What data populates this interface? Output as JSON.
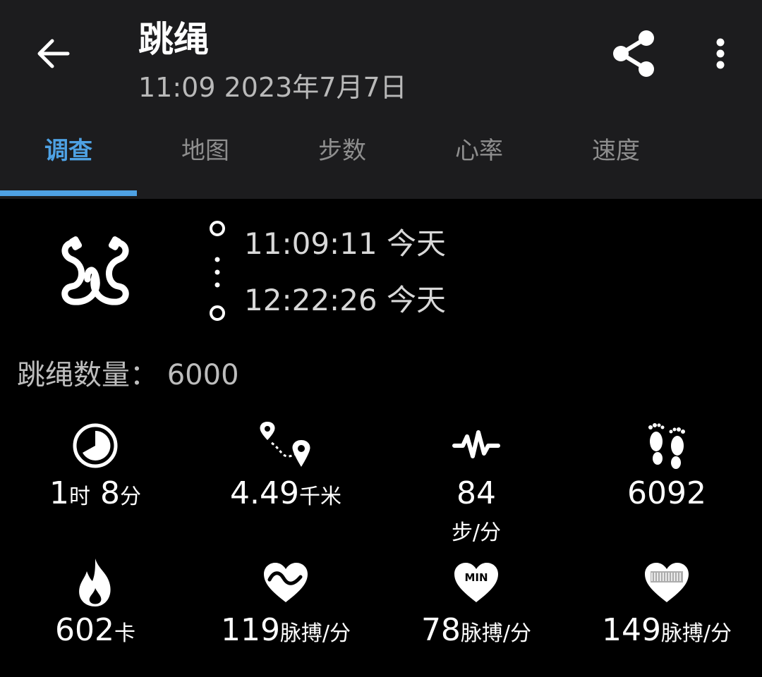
{
  "header": {
    "title": "跳绳",
    "subtitle": "11:09 2023年7月7日",
    "back_icon": "arrow-left-icon",
    "share_icon": "share-icon",
    "more_icon": "more-vert-icon"
  },
  "tabs": [
    {
      "label": "调查",
      "active": true
    },
    {
      "label": "地图",
      "active": false
    },
    {
      "label": "步数",
      "active": false
    },
    {
      "label": "心率",
      "active": false
    },
    {
      "label": "速度",
      "active": false
    }
  ],
  "accent_color": "#4ea1e3",
  "summary": {
    "activity_icon": "jump-rope-icon",
    "start_time": "11:09:11 今天",
    "end_time": "12:22:26 今天",
    "count_label": "跳绳数量：",
    "count_value": "6000"
  },
  "stats": [
    {
      "icon": "clock-icon",
      "value": "1",
      "unit": "时",
      "value2": " 8",
      "unit2": "分"
    },
    {
      "icon": "route-icon",
      "value": "4.49",
      "unit": "千米"
    },
    {
      "icon": "cadence-icon",
      "value": "84",
      "unit": "步/分"
    },
    {
      "icon": "footprints-icon",
      "value": "6092",
      "unit": ""
    },
    {
      "icon": "flame-icon",
      "value": "602",
      "unit": "卡"
    },
    {
      "icon": "heart-wave-icon",
      "value": "119",
      "unit": "脉搏/分"
    },
    {
      "icon": "heart-min-icon",
      "icon_text": "MIN",
      "value": "78",
      "unit": "脉搏/分"
    },
    {
      "icon": "heart-max-icon",
      "value": "149",
      "unit": "脉搏/分"
    }
  ]
}
